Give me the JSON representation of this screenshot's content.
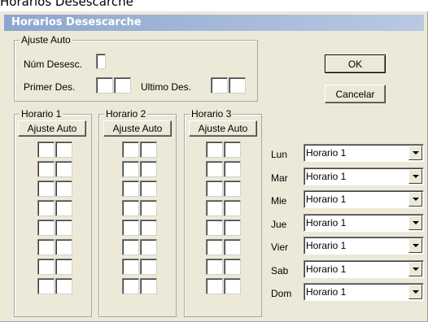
{
  "window_title_partial": "Horarios Desescarche",
  "dialog_title": "Horarios Desescarche",
  "ajuste_auto": {
    "legend": "Ajuste Auto",
    "num_desesc_label": "Núm Desesc.",
    "primer_des_label": "Primer Des.",
    "ultimo_des_label": "Ultimo Des."
  },
  "buttons": {
    "ok": "OK",
    "cancel": "Cancelar"
  },
  "horarios": [
    {
      "legend": "Horario 1",
      "button": "Ajuste Auto"
    },
    {
      "legend": "Horario 2",
      "button": "Ajuste Auto"
    },
    {
      "legend": "Horario 3",
      "button": "Ajuste Auto"
    }
  ],
  "days": [
    {
      "label": "Lun",
      "value": "Horario 1"
    },
    {
      "label": "Mar",
      "value": "Horario 1"
    },
    {
      "label": "Mie",
      "value": "Horario 1"
    },
    {
      "label": "Jue",
      "value": "Horario 1"
    },
    {
      "label": "Vier",
      "value": "Horario 1"
    },
    {
      "label": "Sab",
      "value": "Horario 1"
    },
    {
      "label": "Dom",
      "value": "Horario 1"
    }
  ]
}
